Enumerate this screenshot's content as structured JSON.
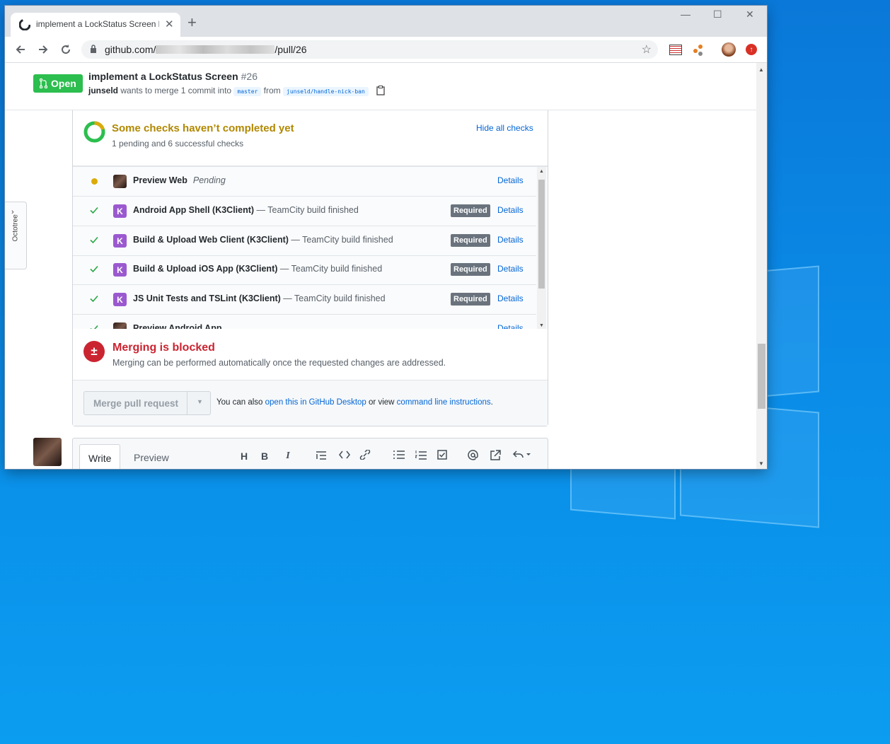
{
  "browser": {
    "tab_title": "implement a LockStatus Screen b",
    "new_tab": "+",
    "url_prefix": "github.com/",
    "url_suffix": "/pull/26",
    "star": "☆",
    "min": "—",
    "max": "☐",
    "close": "✕"
  },
  "pr": {
    "state": "Open",
    "title": "implement a LockStatus Screen",
    "number": "#26",
    "author": "junseld",
    "meta_mid": " wants to merge 1 commit into ",
    "base_branch": "master",
    "from": " from ",
    "head_branch": "junseld/handle-nick-ban"
  },
  "octotree": {
    "label": "Octotree",
    "chevron": "›"
  },
  "checks": {
    "title": "Some checks haven’t completed yet",
    "subtitle": "1 pending and 6 successful checks",
    "hide_link": "Hide all checks",
    "items": [
      {
        "name": "Preview Web",
        "desc": "",
        "status": "Pending",
        "required": "",
        "details": "Details",
        "icon": "avatar-photo"
      },
      {
        "name": "Android App Shell (K3Client)",
        "desc": " — TeamCity build finished",
        "status": "",
        "required": "Required",
        "details": "Details",
        "icon": "teamcity-k"
      },
      {
        "name": "Build & Upload Web Client (K3Client)",
        "desc": " — TeamCity build finished",
        "status": "",
        "required": "Required",
        "details": "Details",
        "icon": "teamcity-k"
      },
      {
        "name": "Build & Upload iOS App (K3Client)",
        "desc": " — TeamCity build finished",
        "status": "",
        "required": "Required",
        "details": "Details",
        "icon": "teamcity-k"
      },
      {
        "name": "JS Unit Tests and TSLint (K3Client)",
        "desc": " — TeamCity build finished",
        "status": "",
        "required": "Required",
        "details": "Details",
        "icon": "teamcity-k"
      },
      {
        "name": "Preview Android App",
        "desc": "",
        "status": "",
        "required": "",
        "details": "Details",
        "icon": "avatar-photo"
      }
    ]
  },
  "blocked": {
    "title": "Merging is blocked",
    "subtitle": "Merging can be performed automatically once the requested changes are addressed."
  },
  "merge": {
    "button": "Merge pull request",
    "hint_pre": "You can also ",
    "hint_link1": "open this in GitHub Desktop",
    "hint_mid": " or view ",
    "hint_link2": "command line instructions",
    "hint_end": "."
  },
  "editor": {
    "write_tab": "Write",
    "preview_tab": "Preview",
    "tools": [
      "H",
      "B",
      "I"
    ]
  },
  "colors": {
    "open_green": "#2cbe4e",
    "pending_yellow": "#b08800",
    "blocked_red": "#cb2431",
    "link_blue": "#0366d6"
  }
}
